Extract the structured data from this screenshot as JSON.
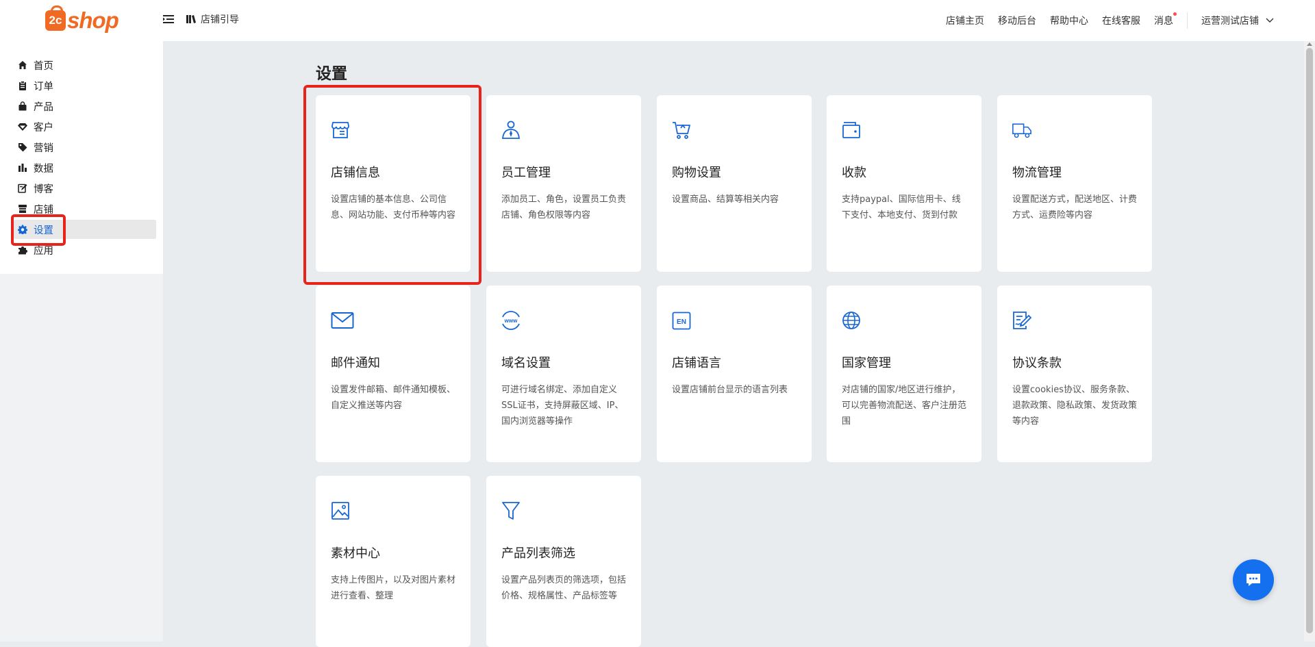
{
  "header": {
    "logo_prefix": "2c",
    "logo_text": "shop",
    "guide_label": "店铺引导",
    "links": [
      "店铺主页",
      "移动后台",
      "帮助中心",
      "在线客服"
    ],
    "messages_label": "消息",
    "store_name": "运营测试店铺"
  },
  "sidebar": {
    "items": [
      {
        "label": "首页",
        "icon": "home-icon"
      },
      {
        "label": "订单",
        "icon": "order-icon"
      },
      {
        "label": "产品",
        "icon": "product-bag-icon"
      },
      {
        "label": "客户",
        "icon": "customer-diamond-icon"
      },
      {
        "label": "营销",
        "icon": "marketing-tag-icon"
      },
      {
        "label": "数据",
        "icon": "data-chart-icon"
      },
      {
        "label": "博客",
        "icon": "blog-edit-icon"
      },
      {
        "label": "店铺",
        "icon": "store-icon"
      },
      {
        "label": "设置",
        "icon": "settings-gear-icon",
        "active": true
      },
      {
        "label": "应用",
        "icon": "apps-puzzle-icon"
      }
    ]
  },
  "main": {
    "title": "设置",
    "cards": [
      {
        "title": "店铺信息",
        "desc": "设置店铺的基本信息、公司信息、网站功能、支付币种等内容",
        "icon": "store-info-icon"
      },
      {
        "title": "员工管理",
        "desc": "添加员工、角色，设置员工负责店铺、角色权限等内容",
        "icon": "staff-icon"
      },
      {
        "title": "购物设置",
        "desc": "设置商品、结算等相关内容",
        "icon": "shopping-cart-icon"
      },
      {
        "title": "收款",
        "desc": "支持paypal、国际信用卡、线下支付、本地支付、货到付款",
        "icon": "wallet-icon"
      },
      {
        "title": "物流管理",
        "desc": "设置配送方式，配送地区、计费方式、运费险等内容",
        "icon": "truck-icon"
      },
      {
        "title": "邮件通知",
        "desc": "设置发件邮箱、邮件通知模板、自定义推送等内容",
        "icon": "mail-icon"
      },
      {
        "title": "域名设置",
        "desc": "可进行域名绑定、添加自定义SSL证书，支持屏蔽区域、IP、国内浏览器等操作",
        "icon": "www-domain-icon"
      },
      {
        "title": "店铺语言",
        "desc": "设置店铺前台显示的语言列表",
        "icon": "language-en-icon"
      },
      {
        "title": "国家管理",
        "desc": "对店铺的国家/地区进行维护，可以完善物流配送、客户注册范围",
        "icon": "globe-icon"
      },
      {
        "title": "协议条款",
        "desc": "设置cookies协议、服务条款、退款政策、隐私政策、发货政策等内容",
        "icon": "agreement-icon"
      },
      {
        "title": "素材中心",
        "desc": "支持上传图片，以及对图片素材进行查看、整理",
        "icon": "image-icon"
      },
      {
        "title": "产品列表筛选",
        "desc": "设置产品列表页的筛选项，包括价格、规格属性、产品标签等",
        "icon": "filter-funnel-icon"
      }
    ]
  },
  "colors": {
    "accent": "#1766d6",
    "brand": "#f06a23",
    "highlight": "#e8231c",
    "background": "#e9ecef"
  }
}
